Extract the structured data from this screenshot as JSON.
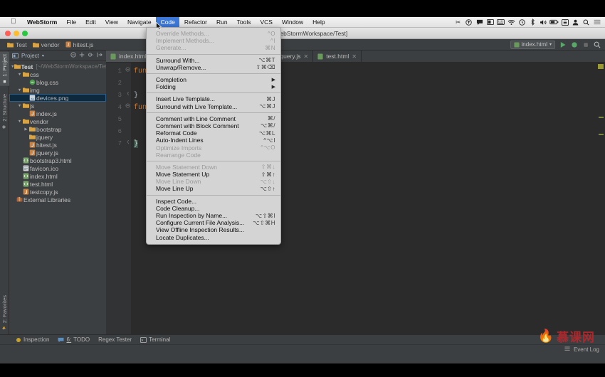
{
  "macbar": {
    "apple_icon": "apple-icon",
    "items": [
      {
        "label": "WebStorm",
        "bold": true,
        "active": false
      },
      {
        "label": "File",
        "bold": false,
        "active": false
      },
      {
        "label": "Edit",
        "bold": false,
        "active": false
      },
      {
        "label": "View",
        "bold": false,
        "active": false
      },
      {
        "label": "Navigate",
        "bold": false,
        "active": false
      },
      {
        "label": "Code",
        "bold": false,
        "active": true
      },
      {
        "label": "Refactor",
        "bold": false,
        "active": false
      },
      {
        "label": "Run",
        "bold": false,
        "active": false
      },
      {
        "label": "Tools",
        "bold": false,
        "active": false
      },
      {
        "label": "VCS",
        "bold": false,
        "active": false
      },
      {
        "label": "Window",
        "bold": false,
        "active": false
      },
      {
        "label": "Help",
        "bold": false,
        "active": false
      }
    ],
    "sysicons": [
      "scissors-icon",
      "upload-circle-icon",
      "speech-bubble-icon",
      "screen-record-icon",
      "keyboard-icon",
      "wifi-icon",
      "clock-icon",
      "bluetooth-icon",
      "volume-icon",
      "battery-icon",
      "display-icon",
      "user-icon",
      "spotlight-search-icon",
      "list-menu-icon"
    ]
  },
  "window": {
    "title": "st - [~/WebStormWorkspace/Test]",
    "traffic": [
      "close-button",
      "minimize-button",
      "zoom-button"
    ]
  },
  "navbar": {
    "crumbs": [
      {
        "label": "Test",
        "icon": "folder-icon"
      },
      {
        "label": "vendor",
        "icon": "folder-icon"
      },
      {
        "label": "hitest.js",
        "icon": "js-file-icon"
      }
    ],
    "run_config": "index.html",
    "buttons": [
      "run-button",
      "debug-button",
      "stop-button",
      "search-everywhere-button"
    ]
  },
  "leftstrip": {
    "tabs": [
      {
        "label": "1: Project",
        "selected": true,
        "icon": "project-icon"
      },
      {
        "label": "2: Structure",
        "selected": false,
        "icon": "structure-icon"
      },
      {
        "label": "2: Favorites",
        "selected": false,
        "icon": "star-icon"
      }
    ]
  },
  "project": {
    "title": "Project",
    "toolbar_icons": [
      "collapse-all-icon",
      "locate-file-icon",
      "settings-icon",
      "hide-panel-icon"
    ],
    "root": {
      "label": "Test",
      "path": "[~/WebStormWorkspace/Test]"
    },
    "tree": [
      {
        "depth": 0,
        "label": "Test",
        "path": "[~/WebStormWorkspace/Test]",
        "icon": "folder-module-icon",
        "twisty": "down",
        "bold": true,
        "selected": false
      },
      {
        "depth": 1,
        "label": "css",
        "path": "",
        "icon": "folder-icon",
        "twisty": "down",
        "bold": false,
        "selected": false
      },
      {
        "depth": 2,
        "label": "blog.css",
        "path": "",
        "icon": "css-file-icon",
        "twisty": "",
        "bold": false,
        "selected": false
      },
      {
        "depth": 1,
        "label": "img",
        "path": "",
        "icon": "folder-icon",
        "twisty": "down",
        "bold": false,
        "selected": false
      },
      {
        "depth": 2,
        "label": "devices.png",
        "path": "",
        "icon": "image-file-icon",
        "twisty": "",
        "bold": false,
        "selected": true
      },
      {
        "depth": 1,
        "label": "js",
        "path": "",
        "icon": "folder-icon",
        "twisty": "down",
        "bold": false,
        "selected": false
      },
      {
        "depth": 2,
        "label": "index.js",
        "path": "",
        "icon": "js-file-icon",
        "twisty": "",
        "bold": false,
        "selected": false
      },
      {
        "depth": 1,
        "label": "vendor",
        "path": "",
        "icon": "folder-icon",
        "twisty": "down",
        "bold": false,
        "selected": false
      },
      {
        "depth": 2,
        "label": "bootstrap",
        "path": "",
        "icon": "folder-icon",
        "twisty": "right",
        "bold": false,
        "selected": false
      },
      {
        "depth": 2,
        "label": "jquery",
        "path": "",
        "icon": "folder-icon",
        "twisty": "",
        "bold": false,
        "selected": false
      },
      {
        "depth": 2,
        "label": "hitest.js",
        "path": "",
        "icon": "js-file-icon",
        "twisty": "",
        "bold": false,
        "selected": false
      },
      {
        "depth": 2,
        "label": "jquery.js",
        "path": "",
        "icon": "js-file-icon",
        "twisty": "",
        "bold": false,
        "selected": false
      },
      {
        "depth": 1,
        "label": "bootstrap3.html",
        "path": "",
        "icon": "html-file-icon",
        "twisty": "",
        "bold": false,
        "selected": false
      },
      {
        "depth": 1,
        "label": "favicon.ico",
        "path": "",
        "icon": "file-icon",
        "twisty": "",
        "bold": false,
        "selected": false
      },
      {
        "depth": 1,
        "label": "index.html",
        "path": "",
        "icon": "html-file-icon",
        "twisty": "",
        "bold": false,
        "selected": false
      },
      {
        "depth": 1,
        "label": "test.html",
        "path": "",
        "icon": "html-file-icon",
        "twisty": "",
        "bold": false,
        "selected": false
      },
      {
        "depth": 1,
        "label": "testcopy.js",
        "path": "",
        "icon": "js-file-icon",
        "twisty": "",
        "bold": false,
        "selected": false
      },
      {
        "depth": 0,
        "label": "External Libraries",
        "path": "",
        "icon": "library-icon",
        "twisty": "",
        "bold": false,
        "selected": false
      }
    ]
  },
  "editor": {
    "tabs": [
      {
        "label": "index.html",
        "icon": "html-file-icon",
        "active": true
      },
      {
        "label": "jquery.js",
        "icon": "js-file-icon",
        "active": false
      },
      {
        "label": "test.html",
        "icon": "html-file-icon",
        "active": false
      }
    ],
    "line_numbers": [
      "1",
      "2",
      "3",
      "4",
      "5",
      "6",
      "7"
    ],
    "lines": [
      {
        "n": "1",
        "kw": "func",
        "rest": "",
        "brace": "",
        "hl": false
      },
      {
        "n": "2",
        "kw": "",
        "rest": "",
        "brace": "",
        "hl": false
      },
      {
        "n": "3",
        "kw": "",
        "rest": "",
        "brace": "}",
        "hl": false
      },
      {
        "n": "4",
        "kw": "func",
        "rest": "",
        "brace": "",
        "hl": false
      },
      {
        "n": "5",
        "kw": "",
        "rest": "",
        "brace": "",
        "hl": false
      },
      {
        "n": "6",
        "kw": "",
        "rest": "",
        "brace": "",
        "hl": false
      },
      {
        "n": "7",
        "kw": "",
        "rest": "",
        "brace": "}",
        "hl": true
      }
    ]
  },
  "code_menu": {
    "title": "Code",
    "items": [
      {
        "label": "Override Methods...",
        "shortcut": "^O",
        "disabled": true,
        "submenu": false,
        "separator_after": false
      },
      {
        "label": "Implement Methods...",
        "shortcut": "^I",
        "disabled": true,
        "submenu": false,
        "separator_after": false
      },
      {
        "label": "Generate...",
        "shortcut": "⌘N",
        "disabled": true,
        "submenu": false,
        "separator_after": true
      },
      {
        "label": "Surround With...",
        "shortcut": "⌥⌘T",
        "disabled": false,
        "submenu": false,
        "separator_after": false
      },
      {
        "label": "Unwrap/Remove...",
        "shortcut": "⇧⌘⌫",
        "disabled": false,
        "submenu": false,
        "separator_after": true
      },
      {
        "label": "Completion",
        "shortcut": "",
        "disabled": false,
        "submenu": true,
        "separator_after": false
      },
      {
        "label": "Folding",
        "shortcut": "",
        "disabled": false,
        "submenu": true,
        "separator_after": true
      },
      {
        "label": "Insert Live Template...",
        "shortcut": "⌘J",
        "disabled": false,
        "submenu": false,
        "separator_after": false
      },
      {
        "label": "Surround with Live Template...",
        "shortcut": "⌥⌘J",
        "disabled": false,
        "submenu": false,
        "separator_after": true
      },
      {
        "label": "Comment with Line Comment",
        "shortcut": "⌘/",
        "disabled": false,
        "submenu": false,
        "separator_after": false
      },
      {
        "label": "Comment with Block Comment",
        "shortcut": "⌥⌘/",
        "disabled": false,
        "submenu": false,
        "separator_after": false
      },
      {
        "label": "Reformat Code",
        "shortcut": "⌥⌘L",
        "disabled": false,
        "submenu": false,
        "separator_after": false
      },
      {
        "label": "Auto-Indent Lines",
        "shortcut": "^⌥I",
        "disabled": false,
        "submenu": false,
        "separator_after": false
      },
      {
        "label": "Optimize Imports",
        "shortcut": "^⌥O",
        "disabled": true,
        "submenu": false,
        "separator_after": false
      },
      {
        "label": "Rearrange Code",
        "shortcut": "",
        "disabled": true,
        "submenu": false,
        "separator_after": true
      },
      {
        "label": "Move Statement Down",
        "shortcut": "⇧⌘↓",
        "disabled": true,
        "submenu": false,
        "separator_after": false
      },
      {
        "label": "Move Statement Up",
        "shortcut": "⇧⌘↑",
        "disabled": false,
        "submenu": false,
        "separator_after": false
      },
      {
        "label": "Move Line Down",
        "shortcut": "⌥⇧↓",
        "disabled": true,
        "submenu": false,
        "separator_after": false
      },
      {
        "label": "Move Line Up",
        "shortcut": "⌥⇧↑",
        "disabled": false,
        "submenu": false,
        "separator_after": true
      },
      {
        "label": "Inspect Code...",
        "shortcut": "",
        "disabled": false,
        "submenu": false,
        "separator_after": false
      },
      {
        "label": "Code Cleanup...",
        "shortcut": "",
        "disabled": false,
        "submenu": false,
        "separator_after": false
      },
      {
        "label": "Run Inspection by Name...",
        "shortcut": "⌥⇧⌘I",
        "disabled": false,
        "submenu": false,
        "separator_after": false
      },
      {
        "label": "Configure Current File Analysis...",
        "shortcut": "⌥⇧⌘H",
        "disabled": false,
        "submenu": false,
        "separator_after": false
      },
      {
        "label": "View Offline Inspection Results...",
        "shortcut": "",
        "disabled": false,
        "submenu": false,
        "separator_after": false
      },
      {
        "label": "Locate Duplicates...",
        "shortcut": "",
        "disabled": false,
        "submenu": false,
        "separator_after": false
      }
    ]
  },
  "bottombar": {
    "items": [
      {
        "label": "Inspection",
        "icon": "inspection-icon",
        "prefix": ""
      },
      {
        "label": "TODO",
        "icon": "todo-icon",
        "prefix": "6:"
      },
      {
        "label": "Regex Tester",
        "icon": "",
        "prefix": ""
      },
      {
        "label": "Terminal",
        "icon": "terminal-icon",
        "prefix": ""
      }
    ]
  },
  "statusbar": {
    "event_log": "Event Log",
    "event_log_icon": "event-log-icon"
  },
  "watermark": {
    "text": "慕课网",
    "flame_icon": "flame-icon",
    "color": "#b4282d"
  },
  "colors": {
    "ide_panel": "#3c3f41",
    "editor_bg": "#2b2b2b",
    "gutter_bg": "#313335",
    "selection": "#0d293e",
    "menu_bg": "#d4d4d4",
    "menu_highlight": "#3c78d8",
    "keyword": "#cc7832",
    "watermark": "#b4282d"
  }
}
